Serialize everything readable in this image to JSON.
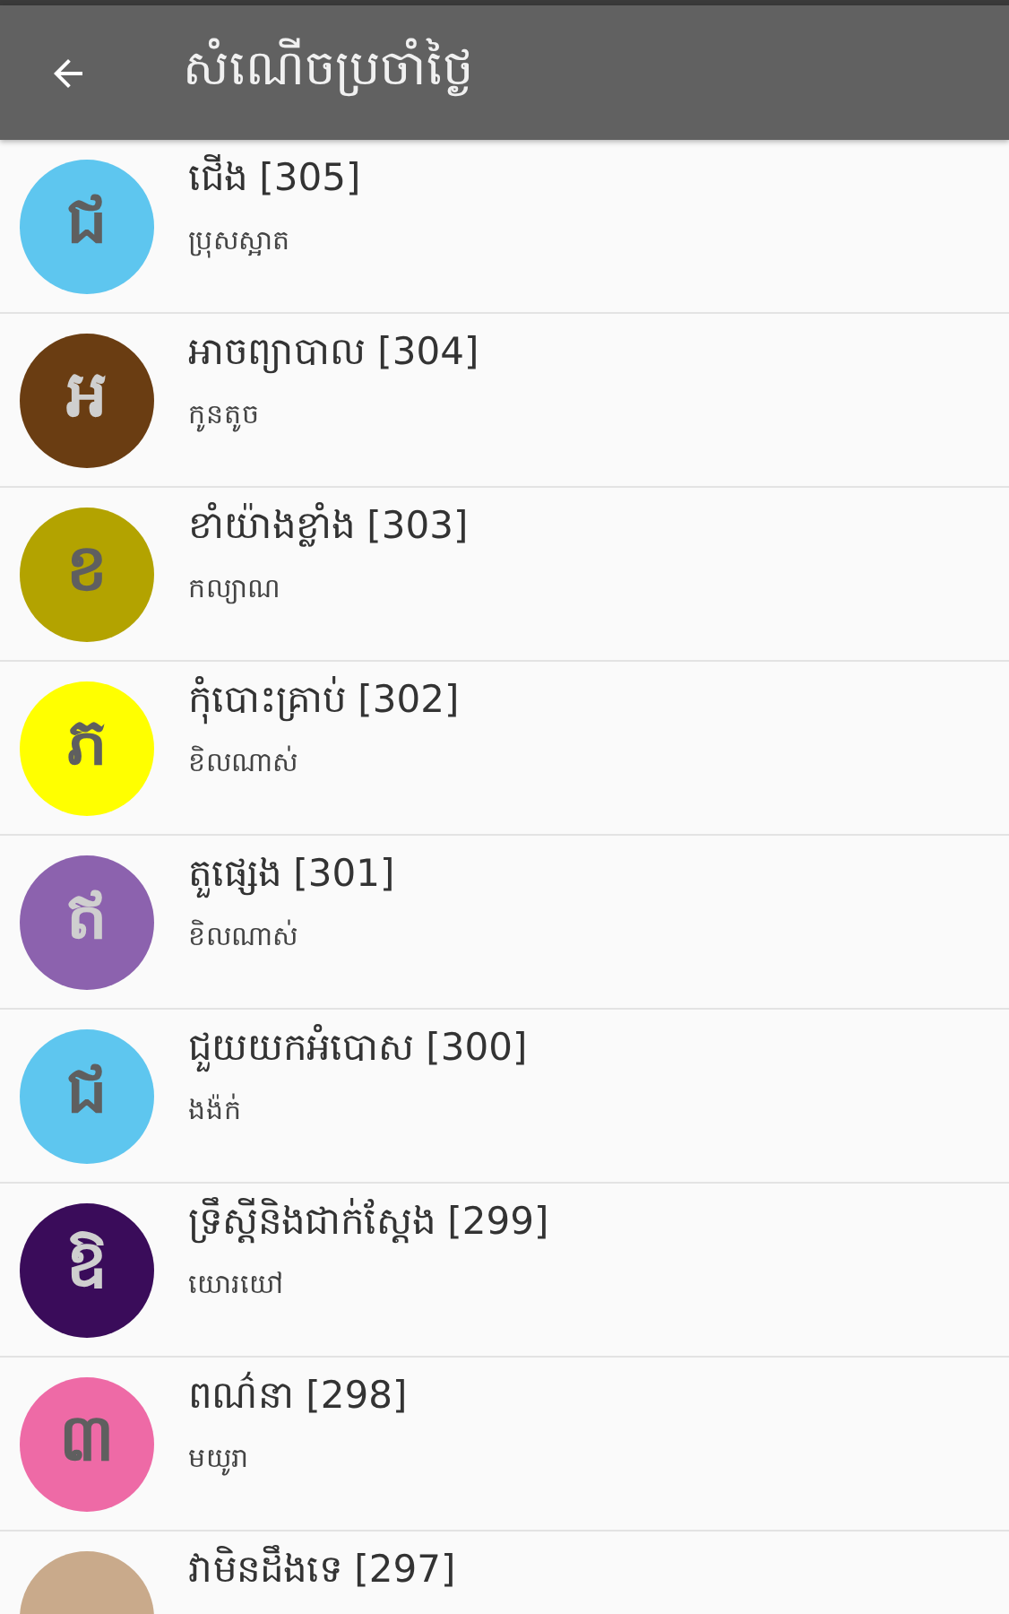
{
  "app_bar": {
    "title": "សំណើចប្រចាំថ្ងៃ"
  },
  "items": [
    {
      "avatar_letter": "ជ",
      "color": "#5ec6ef",
      "title": "ជើង [305]",
      "subtitle": "ប្រុសស្អាត"
    },
    {
      "avatar_letter": "អ",
      "color": "#6a3d12",
      "title": "អាចព្យាបាល [304]",
      "subtitle": "កូនតូច"
    },
    {
      "avatar_letter": "ខ",
      "color": "#b3a300",
      "title": "ខាំយ៉ាងខ្លាំង [303]",
      "subtitle": "កល្យាណ"
    },
    {
      "avatar_letter": "ភ",
      "color": "#ffff00",
      "title": "កុំបោះគ្រាប់ [302]",
      "subtitle": "ខិលណាស់"
    },
    {
      "avatar_letter": "ឥ",
      "color": "#8c62ae",
      "title": "តួផ្សេង [301]",
      "subtitle": "ខិលណាស់"
    },
    {
      "avatar_letter": "ជ",
      "color": "#5ec6ef",
      "title": "ជួយយកអំបោស [300]",
      "subtitle": "ងង៉ក់"
    },
    {
      "avatar_letter": "ឱ",
      "color": "#3a0c5a",
      "title": "ទ្រឹស្តីនិងជាក់ស្តែង [299]",
      "subtitle": "យោរយៅ"
    },
    {
      "avatar_letter": "៣",
      "color": "#ee6aa6",
      "title": "ពណ៌នា [298]",
      "subtitle": "មយូរា"
    },
    {
      "color": "#c9aa8b",
      "title": "វាមិនដឹងទេ [297]"
    }
  ]
}
